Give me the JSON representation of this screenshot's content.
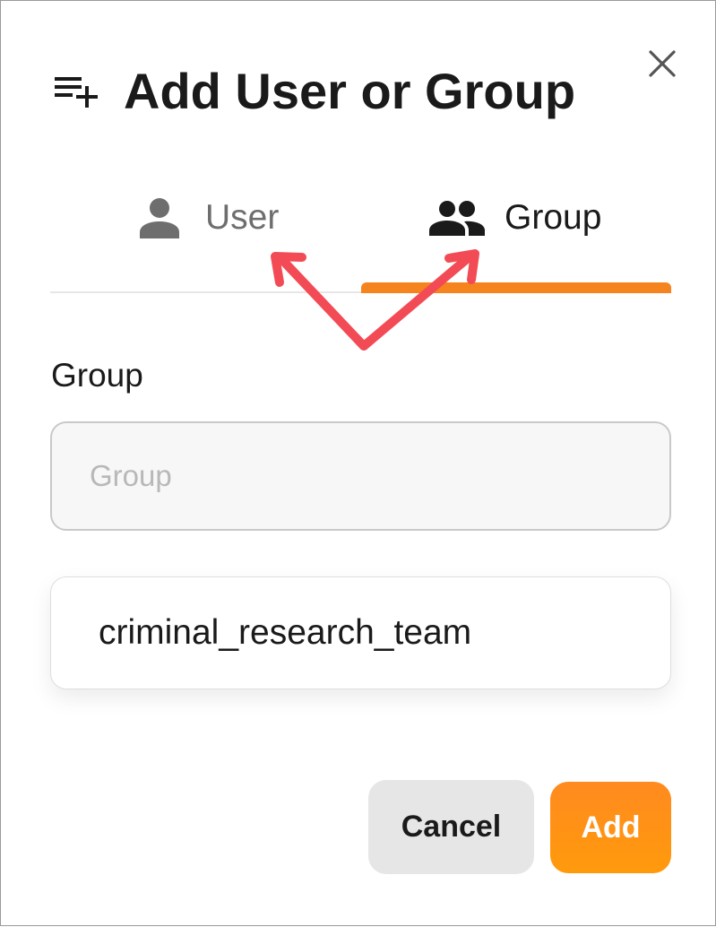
{
  "dialog": {
    "title": "Add User or Group",
    "title_icon": "playlist-add-icon",
    "close_icon": "close-icon"
  },
  "tabs": [
    {
      "label": "User",
      "icon": "person-icon",
      "active": false
    },
    {
      "label": "Group",
      "icon": "group-icon",
      "active": true
    }
  ],
  "form": {
    "field_label": "Group",
    "input_placeholder": "Group",
    "input_value": "",
    "suggestion": "criminal_research_team"
  },
  "buttons": {
    "cancel_label": "Cancel",
    "add_label": "Add"
  },
  "colors": {
    "accent": "#f5841f",
    "add_button": "#ff9a0c",
    "annotation_arrow": "#f24b55",
    "cancel_button": "#e6e6e6"
  }
}
